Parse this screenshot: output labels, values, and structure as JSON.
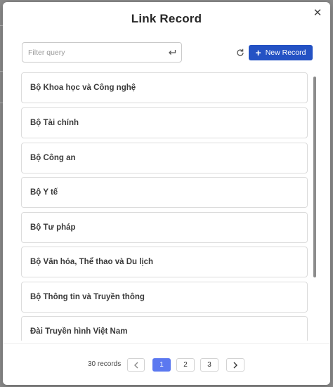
{
  "dialog": {
    "title": "Link Record",
    "close_icon": "close-icon"
  },
  "filter": {
    "placeholder": "Filter query",
    "value": "",
    "submit_icon": "enter-return-icon"
  },
  "toolbar": {
    "refresh_icon": "refresh-icon",
    "new_record_label": "New Record",
    "new_record_icon": "plus-icon",
    "accent_color": "#2452c4"
  },
  "records": [
    {
      "label": "Bộ Khoa học và Công nghệ"
    },
    {
      "label": "Bộ Tài chính"
    },
    {
      "label": "Bộ Công an"
    },
    {
      "label": "Bộ Y tế"
    },
    {
      "label": "Bộ Tư pháp"
    },
    {
      "label": "Bộ Văn hóa, Thể thao và Du lịch"
    },
    {
      "label": "Bộ Thông tin và Truyền thông"
    },
    {
      "label": "Đài Truyền hình Việt Nam"
    }
  ],
  "pagination": {
    "count_label": "30 records",
    "prev_icon": "chevron-left-icon",
    "next_icon": "chevron-right-icon",
    "pages": [
      "1",
      "2",
      "3"
    ],
    "current_page": "1",
    "active_color": "#5b78f0"
  }
}
